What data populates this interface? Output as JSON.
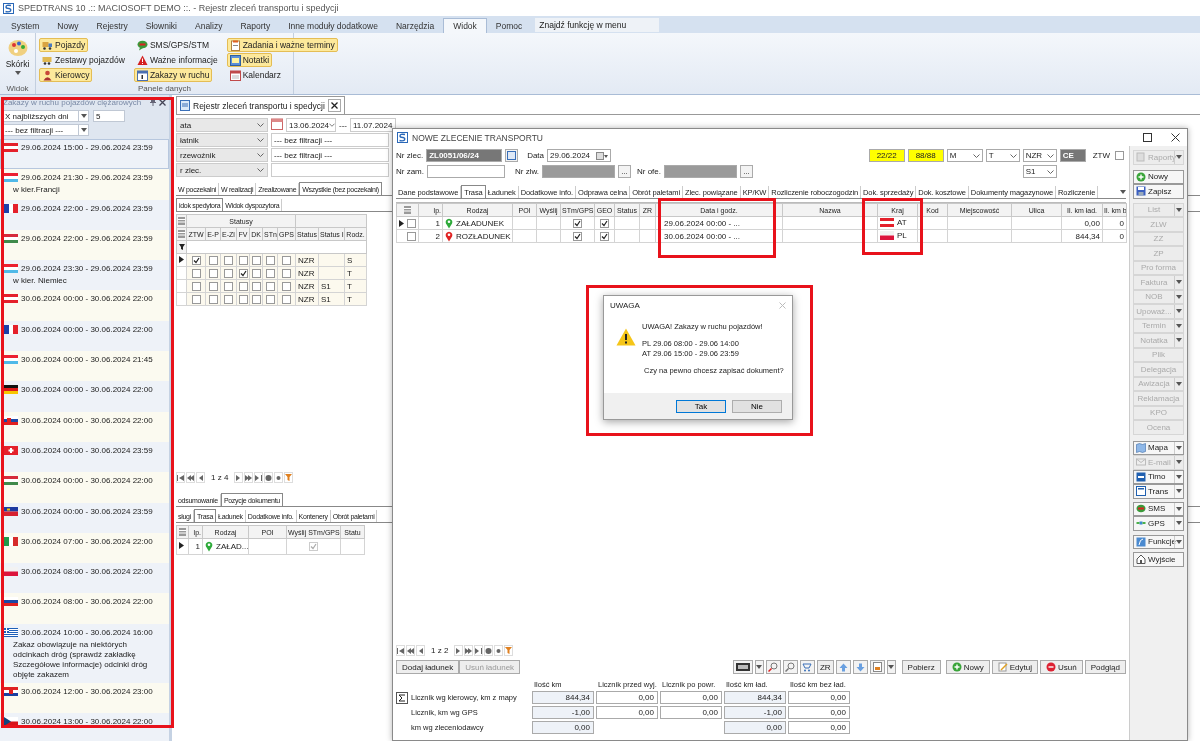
{
  "window": {
    "title": "SPEDTRANS 10 .:: MACIOSOFT DEMO ::. - Rejestr zleceń transportu i spedycji"
  },
  "menu": {
    "tabs": [
      {
        "label": "System",
        "selected": false
      },
      {
        "label": "Nowy",
        "selected": false
      },
      {
        "label": "Rejestry",
        "selected": false
      },
      {
        "label": "Słowniki",
        "selected": false
      },
      {
        "label": "Analizy",
        "selected": false
      },
      {
        "label": "Raporty",
        "selected": false
      },
      {
        "label": "Inne moduły dodatkowe",
        "selected": false
      },
      {
        "label": "Narzędzia",
        "selected": false
      },
      {
        "label": "Widok",
        "selected": true
      },
      {
        "label": "Pomoc",
        "selected": false
      }
    ],
    "search": {
      "placeholder": "Znajdź funkcję w menu"
    }
  },
  "ribbon": {
    "skins": {
      "label": "Skórki"
    },
    "view_group": "Widok",
    "panels_group": "Panele danych",
    "columns": [
      [
        {
          "label": "Pojazdy",
          "kind": "truck",
          "on": true
        },
        {
          "label": "Zestawy pojazdów",
          "kind": "trailer",
          "on": false
        },
        {
          "label": "Kierowcy",
          "kind": "driver",
          "on": true
        }
      ],
      [
        {
          "label": "SMS/GPS/STM",
          "kind": "sms",
          "on": false
        },
        {
          "label": "Ważne informacje",
          "kind": "warning",
          "on": false
        },
        {
          "label": "Zakazy w ruchu",
          "kind": "day",
          "on": true
        }
      ],
      [
        {
          "label": "Zadania i ważne terminy",
          "kind": "tasks",
          "on": true
        },
        {
          "label": "Notatki",
          "kind": "note",
          "on": true
        },
        {
          "label": "Kalendarz",
          "kind": "calendar",
          "on": false
        }
      ]
    ]
  },
  "bans_panel": {
    "title": "Zakazy w ruchu pojazdów ciężarowych",
    "range": "X najbliższych dni",
    "days": "5",
    "filter": "--- bez filtracji ---",
    "items": [
      {
        "kind": "at",
        "period": "29.06.2024 15:00 - 29.06.2024 23:59",
        "selected": true
      },
      {
        "kind": "lu",
        "period": "29.06.2024 21:30 - 29.06.2024 23:59",
        "note": "w kier.Francji",
        "selected": false
      },
      {
        "kind": "fr",
        "period": "29.06.2024 22:00 - 29.06.2024 23:59",
        "selected": false
      },
      {
        "kind": "hu",
        "period": "29.06.2024 22:00 - 29.06.2024 23:59",
        "selected": false
      },
      {
        "kind": "lu",
        "period": "29.06.2024 23:30 - 29.06.2024 23:59",
        "note": "w kier. Niemiec",
        "selected": false
      },
      {
        "kind": "at",
        "period": "30.06.2024 00:00 - 30.06.2024 22:00",
        "selected": false
      },
      {
        "kind": "fr",
        "period": "30.06.2024 00:00 - 30.06.2024 22:00",
        "selected": false
      },
      {
        "kind": "lu",
        "period": "30.06.2024 00:00 - 30.06.2024 21:45",
        "selected": false
      },
      {
        "kind": "de",
        "period": "30.06.2024 00:00 - 30.06.2024 22:00",
        "selected": false
      },
      {
        "kind": "sk",
        "period": "30.06.2024 00:00 - 30.06.2024 22:00",
        "selected": false
      },
      {
        "kind": "ch",
        "period": "30.06.2024 00:00 - 30.06.2024 23:59",
        "selected": false
      },
      {
        "kind": "hu",
        "period": "30.06.2024 00:00 - 30.06.2024 22:00",
        "selected": false
      },
      {
        "kind": "li",
        "period": "30.06.2024 00:00 - 30.06.2024 23:59",
        "selected": false
      },
      {
        "kind": "it",
        "period": "30.06.2024 07:00 - 30.06.2024 22:00",
        "selected": false
      },
      {
        "kind": "pl",
        "period": "30.06.2024 08:00 - 30.06.2024 22:00",
        "selected": false
      },
      {
        "kind": "si",
        "period": "30.06.2024 08:00 - 30.06.2024 22:00",
        "selected": false
      },
      {
        "kind": "gr",
        "period": "30.06.2024 10:00 - 30.06.2024 16:00",
        "note": "Zakaz obowiązuje na niektórych odcinkach dróg (sprawdź zakładkę Szczegółowe informacje) odcinki dróg objęte zakazem",
        "selected": false
      },
      {
        "kind": "hr",
        "period": "30.06.2024 12:00 - 30.06.2024 23:00",
        "selected": false
      },
      {
        "kind": "cz",
        "period": "30.06.2024 13:00 - 30.06.2024 22:00",
        "selected": false
      }
    ]
  },
  "register": {
    "tab": "Rejestr zleceń transportu i spedycji",
    "filters": [
      {
        "kind": "date",
        "label": "ata",
        "from": "13.06.2024",
        "separator": "---",
        "to": "11.07.2024"
      },
      {
        "kind": "select",
        "label": "łatnik",
        "value": "--- bez filtracji ---"
      },
      {
        "kind": "select",
        "label": "rzewoźnik",
        "value": "--- bez filtracji ---"
      },
      {
        "kind": "text",
        "label": "r zlec."
      }
    ],
    "tabs": [
      {
        "label": "W poczekalni",
        "selected": false
      },
      {
        "label": "W realizacji",
        "selected": false
      },
      {
        "label": "Zrealizowane",
        "selected": false
      },
      {
        "label": "Wszystkie (bez poczekalni)",
        "selected": true
      }
    ],
    "views": [
      {
        "label": "idok spedytora",
        "selected": true
      },
      {
        "label": "Widok dyspozytora",
        "selected": false
      }
    ],
    "grid": {
      "band": "Statusy",
      "columns": [
        "ZTW",
        "E-P",
        "E-Zl",
        "FV",
        "DK",
        "STn",
        "GPS",
        "Status",
        "Status I",
        "Rodz."
      ],
      "rows": [
        {
          "selected": true,
          "checks": [
            true,
            false,
            false,
            false,
            false,
            false,
            false
          ],
          "status": "NZR",
          "rodz": "S"
        },
        {
          "selected": false,
          "checks": [
            false,
            false,
            false,
            true,
            false,
            false,
            false
          ],
          "status": "NZR",
          "rodz": "T"
        },
        {
          "selected": false,
          "checks": [
            false,
            false,
            false,
            false,
            false,
            false,
            false
          ],
          "status": "NZR",
          "status_i": "S1",
          "rodz": "T"
        },
        {
          "selected": false,
          "checks": [
            false,
            false,
            false,
            false,
            false,
            false,
            false
          ],
          "status": "NZR",
          "status_i": "S1",
          "rodz": "T"
        }
      ]
    },
    "pager": "1 z 4",
    "doc_tabs": [
      {
        "label": "odsumowanie",
        "selected": false
      },
      {
        "label": "Pozycje dokumentu",
        "selected": true
      }
    ],
    "item_tabs": [
      {
        "label": "sługi",
        "selected": false
      },
      {
        "label": "Trasa",
        "selected": true
      },
      {
        "label": "Ładunek",
        "selected": false
      },
      {
        "label": "Dodatkowe info.",
        "selected": false
      },
      {
        "label": "Kontenery",
        "selected": false
      },
      {
        "label": "Obrót paletami",
        "selected": false
      }
    ],
    "items_grid": {
      "columns": [
        "lp.",
        "Rodzaj",
        "POI",
        "Wyślij STm/GPS",
        "Statu"
      ],
      "rows": [
        {
          "selected": true,
          "lp": "1",
          "kind": "load",
          "type": "ZAŁAD...",
          "send": true
        }
      ]
    }
  },
  "order": {
    "title": "NOWE ZLECENIE TRANSPORTU",
    "number": {
      "label": "Nr zlec.",
      "value": "ZL0051/06/24"
    },
    "date": {
      "label": "Data",
      "value": "29.06.2024"
    },
    "customer_no": {
      "label": "Nr zam."
    },
    "zlw": {
      "label": "Nr zlw.",
      "browse": "..."
    },
    "offer": {
      "label": "Nr ofe.",
      "browse": "..."
    },
    "counters": [
      "22/22",
      "88/88"
    ],
    "selects": [
      "M",
      "T",
      "NZR"
    ],
    "code": "CE",
    "ztw": {
      "label": "ZTW",
      "checked": false
    },
    "sub_status": "S1",
    "tabs": [
      {
        "label": "Dane podstawowe",
        "selected": false
      },
      {
        "label": "Trasa",
        "selected": true
      },
      {
        "label": "Ładunek",
        "selected": false
      },
      {
        "label": "Dodatkowe info.",
        "selected": false
      },
      {
        "label": "Odprawa celna",
        "selected": false
      },
      {
        "label": "Obrót paletami",
        "selected": false
      },
      {
        "label": "Zlec. powiązane",
        "selected": false
      },
      {
        "label": "KP/KW",
        "selected": false
      },
      {
        "label": "Rozliczenie roboczogodzin",
        "selected": false
      },
      {
        "label": "Dok. sprzedaży",
        "selected": false
      },
      {
        "label": "Dok. kosztowe",
        "selected": false
      },
      {
        "label": "Dokumenty magazynowe",
        "selected": false
      },
      {
        "label": "Rozliczenie",
        "selected": false
      }
    ],
    "grid": {
      "columns": [
        "lp.",
        "Rodzaj",
        "POI",
        "Wyślij",
        "STm/GPS",
        "GEO",
        "Status",
        "ZR",
        "Data i godz.",
        "Nazwa",
        "Kraj",
        "Kod",
        "Miejscowość",
        "Ulica",
        "Il. km ład.",
        "Il. km b"
      ],
      "rows": [
        {
          "selected": true,
          "checked": false,
          "lp": "1",
          "kind": "load",
          "type": "ZAŁADUNEK",
          "stm": true,
          "geo": true,
          "date": "29.06.2024 00:00 - ...",
          "country": {
            "kind": "at",
            "code": "AT"
          },
          "km": "0,00",
          "km_b": "0"
        },
        {
          "selected": false,
          "checked": false,
          "lp": "2",
          "kind": "unload",
          "type": "ROZŁADUNEK",
          "stm": true,
          "geo": true,
          "date": "30.06.2024 00:00 - ...",
          "country": {
            "kind": "pl",
            "code": "PL"
          },
          "km": "844,34",
          "km_b": "0"
        }
      ]
    },
    "pager": "1 z 2",
    "cargo_buttons": [
      {
        "label": "Dodaj ładunek",
        "disabled": false
      },
      {
        "label": "Usuń ładunek",
        "disabled": true
      }
    ],
    "zr": "ZR",
    "toolbar": [
      {
        "label": "Pobierz",
        "kind": "plain"
      },
      {
        "label": "Nowy",
        "kind": "new"
      },
      {
        "label": "Edytuj",
        "kind": "edit"
      },
      {
        "label": "Usuń",
        "kind": "delete"
      },
      {
        "label": "Podgląd",
        "kind": "plain"
      }
    ],
    "summary": {
      "columns": [
        "Ilość km",
        "Licznik przed wyj.",
        "Licznik po powr.",
        "Ilość km ład.",
        "Ilość km bez ład."
      ],
      "rows": [
        {
          "label": "Licznik wg kierowcy, km z mapy",
          "sum": true,
          "km": "844,34",
          "before": "0,00",
          "after": "0,00",
          "loaded": "844,34",
          "empty": "0,00"
        },
        {
          "label": "Licznik, km  wg GPS",
          "sum": false,
          "km": "-1,00",
          "before": "0,00",
          "after": "0,00",
          "loaded": "-1,00",
          "empty": "0,00"
        },
        {
          "label": "km wg zleceniodawcy",
          "sum": false,
          "km": "0,00",
          "loaded": "0,00",
          "empty": "0,00"
        }
      ]
    },
    "button_groups": [
      [
        {
          "label": "Raporty",
          "kind": "report",
          "disabled": true,
          "menu": true
        }
      ],
      [
        {
          "label": "Nowy",
          "kind": "new",
          "disabled": false,
          "menu": false
        },
        {
          "label": "Zapisz",
          "kind": "save",
          "disabled": false,
          "menu": false
        }
      ],
      [
        {
          "label": "List",
          "kind": "plain",
          "disabled": true,
          "menu": true
        },
        {
          "label": "ZLW",
          "kind": "plain",
          "disabled": true,
          "menu": false
        },
        {
          "label": "ZZ",
          "kind": "plain",
          "disabled": true,
          "menu": false
        },
        {
          "label": "ZP",
          "kind": "plain",
          "disabled": true,
          "menu": false
        },
        {
          "label": "Pro forma",
          "kind": "plain",
          "disabled": true,
          "menu": false
        },
        {
          "label": "Faktura",
          "kind": "plain",
          "disabled": true,
          "menu": true
        },
        {
          "label": "NOB",
          "kind": "plain",
          "disabled": true,
          "menu": true
        },
        {
          "label": "Upoważ...",
          "kind": "plain",
          "disabled": true,
          "menu": true
        },
        {
          "label": "Termin",
          "kind": "plain",
          "disabled": true,
          "menu": true
        },
        {
          "label": "Notatka",
          "kind": "plain",
          "disabled": true,
          "menu": true
        },
        {
          "label": "Plik",
          "kind": "plain",
          "disabled": true,
          "menu": false
        },
        {
          "label": "Delegacja",
          "kind": "plain",
          "disabled": true,
          "menu": false
        },
        {
          "label": "Awizacja",
          "kind": "plain",
          "disabled": true,
          "menu": true
        },
        {
          "label": "Reklamacja",
          "kind": "plain",
          "disabled": true,
          "menu": false
        },
        {
          "label": "KPO",
          "kind": "plain",
          "disabled": true,
          "menu": false
        },
        {
          "label": "Ocena",
          "kind": "plain",
          "disabled": true,
          "menu": false
        }
      ],
      [
        {
          "label": "Mapa",
          "kind": "map",
          "disabled": false,
          "menu": true
        },
        {
          "label": "E-mail",
          "kind": "mail",
          "disabled": true,
          "menu": true
        },
        {
          "label": "Timo",
          "kind": "timo",
          "disabled": false,
          "menu": true
        },
        {
          "label": "Trans",
          "kind": "trans",
          "disabled": false,
          "menu": true
        }
      ],
      [
        {
          "label": "SMS",
          "kind": "sms",
          "disabled": false,
          "menu": true
        },
        {
          "label": "GPS",
          "kind": "gps",
          "disabled": false,
          "menu": true
        }
      ],
      [
        {
          "label": "Funkcje",
          "kind": "functions",
          "disabled": false,
          "menu": true
        }
      ],
      [
        {
          "label": "Wyjście",
          "kind": "exit",
          "disabled": false,
          "menu": false
        }
      ]
    ]
  },
  "dialog": {
    "title": "UWAGA",
    "heading": "UWAGA! Zakazy w ruchu pojazdów!",
    "bans": [
      "PL 29.06 08:00 - 29.06 14:00",
      "AT 29.06 15:00 - 29.06 23:59"
    ],
    "question": "Czy na pewno chcesz zapisać dokument?",
    "buttons": [
      {
        "label": "Tak",
        "focused": true
      },
      {
        "label": "Nie",
        "focused": false
      }
    ]
  }
}
